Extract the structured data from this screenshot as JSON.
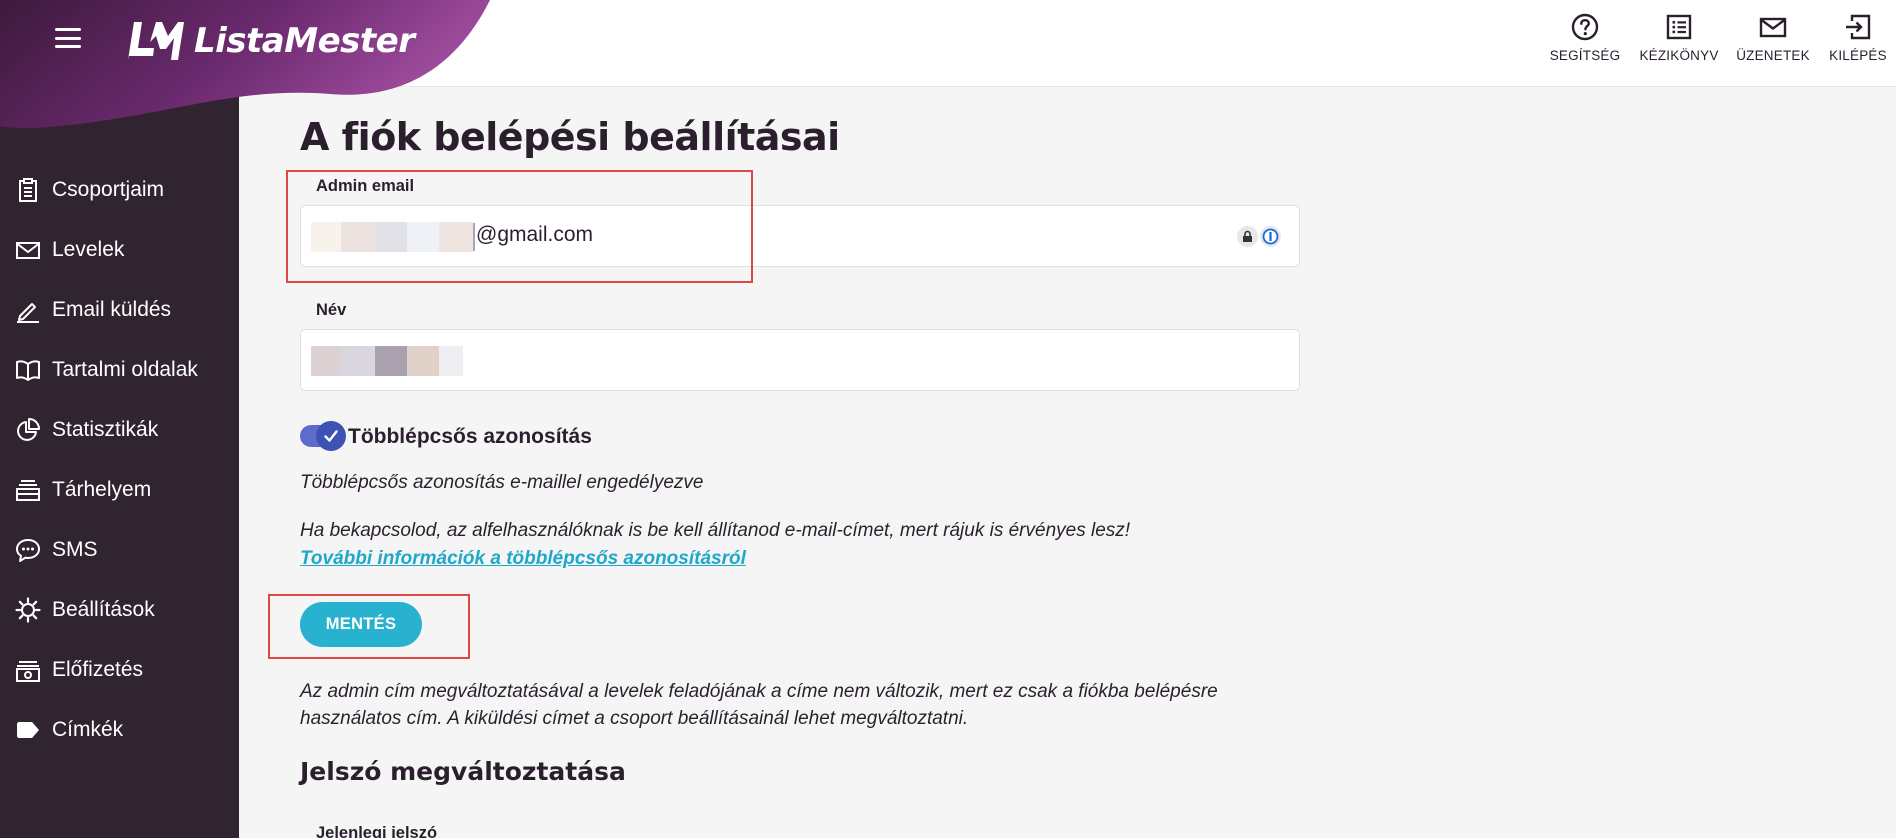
{
  "app": {
    "name": "ListaMester"
  },
  "header": {
    "actions": [
      {
        "label": "SEGÍTSÉG",
        "icon": "help-circle-icon"
      },
      {
        "label": "KÉZIKÖNYV",
        "icon": "list-icon"
      },
      {
        "label": "ÜZENETEK",
        "icon": "mail-icon"
      },
      {
        "label": "KILÉPÉS",
        "icon": "logout-icon"
      }
    ]
  },
  "sidebar": {
    "items": [
      {
        "label": "Csoportjaim",
        "icon": "clipboard-icon"
      },
      {
        "label": "Levelek",
        "icon": "envelope-icon"
      },
      {
        "label": "Email küldés",
        "icon": "pen-icon"
      },
      {
        "label": "Tartalmi oldalak",
        "icon": "book-icon"
      },
      {
        "label": "Statisztikák",
        "icon": "pie-chart-icon"
      },
      {
        "label": "Tárhelyem",
        "icon": "storage-icon"
      },
      {
        "label": "SMS",
        "icon": "chat-bubble-icon"
      },
      {
        "label": "Beállítások",
        "icon": "gear-icon"
      },
      {
        "label": "Előfizetés",
        "icon": "money-icon"
      },
      {
        "label": "Címkék",
        "icon": "tag-icon"
      }
    ]
  },
  "main": {
    "title": "A fiók belépési beállításai",
    "admin_email": {
      "label": "Admin email",
      "value_suffix": "@gmail.com"
    },
    "name_field": {
      "label": "Név"
    },
    "mfa": {
      "label": "Többlépcsős azonosítás",
      "enabled": true,
      "status": "Többlépcsős azonosítás e-maillel engedélyezve",
      "warning": "Ha bekapcsolod, az alfelhasználóknak is be kell állítanod e-mail-címet, mert rájuk is érvényes lesz!",
      "link": "További információk a többlépcsős azonosításról"
    },
    "save_label": "MENTÉS",
    "note": "Az admin cím megváltoztatásával a levelek feladójának a címe nem változik, mert ez csak a fiókba belépésre használatos cím. A kiküldési címet a csoport beállításainál lehet megváltoztatni.",
    "password_section": {
      "title": "Jelszó megváltoztatása",
      "current_label": "Jelenlegi jelszó"
    }
  },
  "colors": {
    "sidebar": "#2f2430",
    "brand_purple": "#6e2c7c",
    "accent": "#29b2cf",
    "toggle": "#3e51b5",
    "annotation": "#e04848"
  }
}
